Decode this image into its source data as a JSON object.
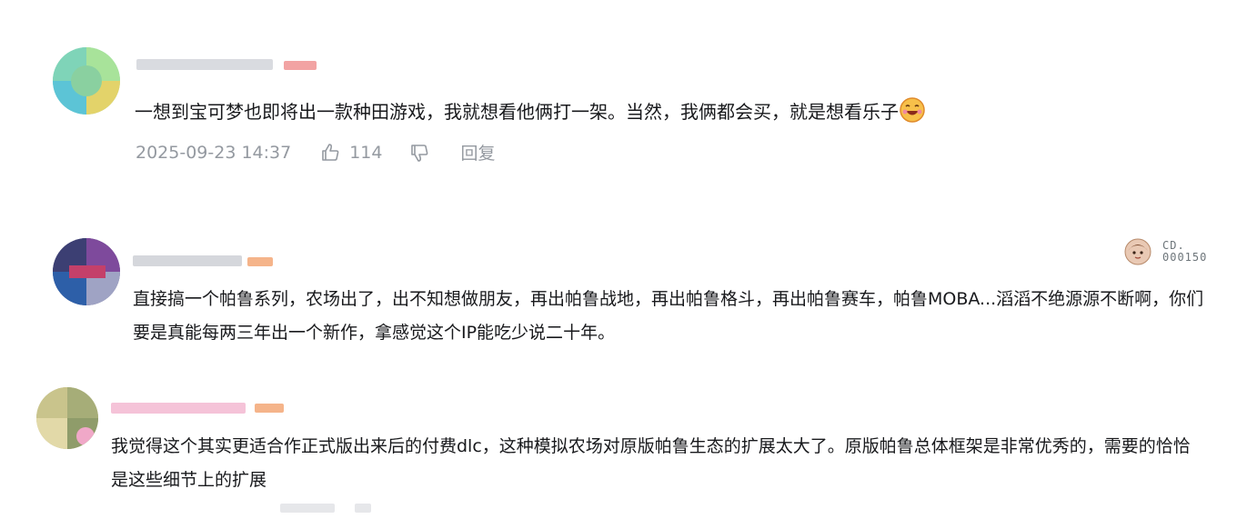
{
  "comments": [
    {
      "text": "一想到宝可梦也即将出一款种田游戏，我就想看他俩打一架。当然，我俩都会买，就是想看乐子",
      "time": "2025-09-23 14:37",
      "likes": "114",
      "reply_label": "回复",
      "emoji_icon": "grinning-hot-face-emoji",
      "avatar_colors": [
        "#7fd4b8",
        "#a8e39a",
        "#5cc4d6",
        "#e3d36a",
        "#8ad0a0"
      ]
    },
    {
      "text": "直接搞一个帕鲁系列，农场出了，出不知想做朋友，再出帕鲁战地，再出帕鲁格斗，再出帕鲁赛车，帕鲁MOBA...滔滔不绝源源不断啊，你们要是真能每两三年出一个新作，拿感觉这个IP能吃少说二十年。",
      "fan_badge_text": [
        "CD.",
        "000150"
      ],
      "avatar_colors": [
        "#3c3f73",
        "#7e4a9c",
        "#c4406a",
        "#2d5fa8",
        "#9fa3c4"
      ]
    },
    {
      "text": "我觉得这个其实更适合作正式版出来后的付费dlc，这种模拟农场对原版帕鲁生态的扩展太大了。原版帕鲁总体框架是非常优秀的，需要的恰恰是这些细节上的扩展",
      "avatar_colors": [
        "#c9c48c",
        "#a6ad78",
        "#e2d9a8",
        "#8f9c6a",
        "#f0a8c8"
      ]
    }
  ],
  "colors": {
    "text_primary": "#18191c",
    "text_secondary": "#9499a0",
    "level_badge": "#f7a6a6",
    "pink_username": "#f5b8d0"
  }
}
